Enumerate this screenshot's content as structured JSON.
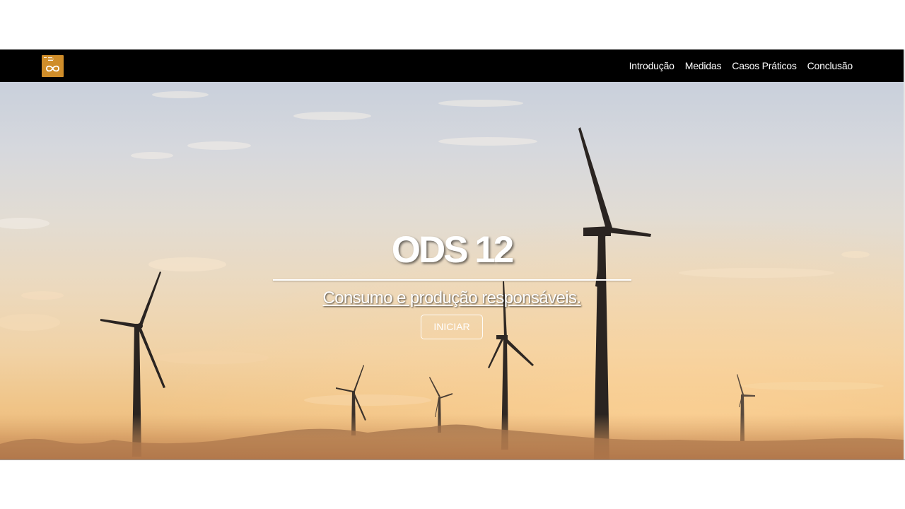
{
  "nav": {
    "logo_alt": "ODS 12 logo",
    "links": [
      {
        "label": "Introdução"
      },
      {
        "label": "Medidas"
      },
      {
        "label": "Casos Práticos"
      },
      {
        "label": "Conclusão"
      }
    ]
  },
  "hero": {
    "title": "ODS 12",
    "subtitle": "Consumo e produção responsáveis.",
    "button_label": "INICIAR",
    "background_description_icon": "wind-turbines-sunset-image"
  },
  "colors": {
    "navbar": "#000000",
    "logo": "#cf8d2a",
    "text": "#ffffff"
  }
}
